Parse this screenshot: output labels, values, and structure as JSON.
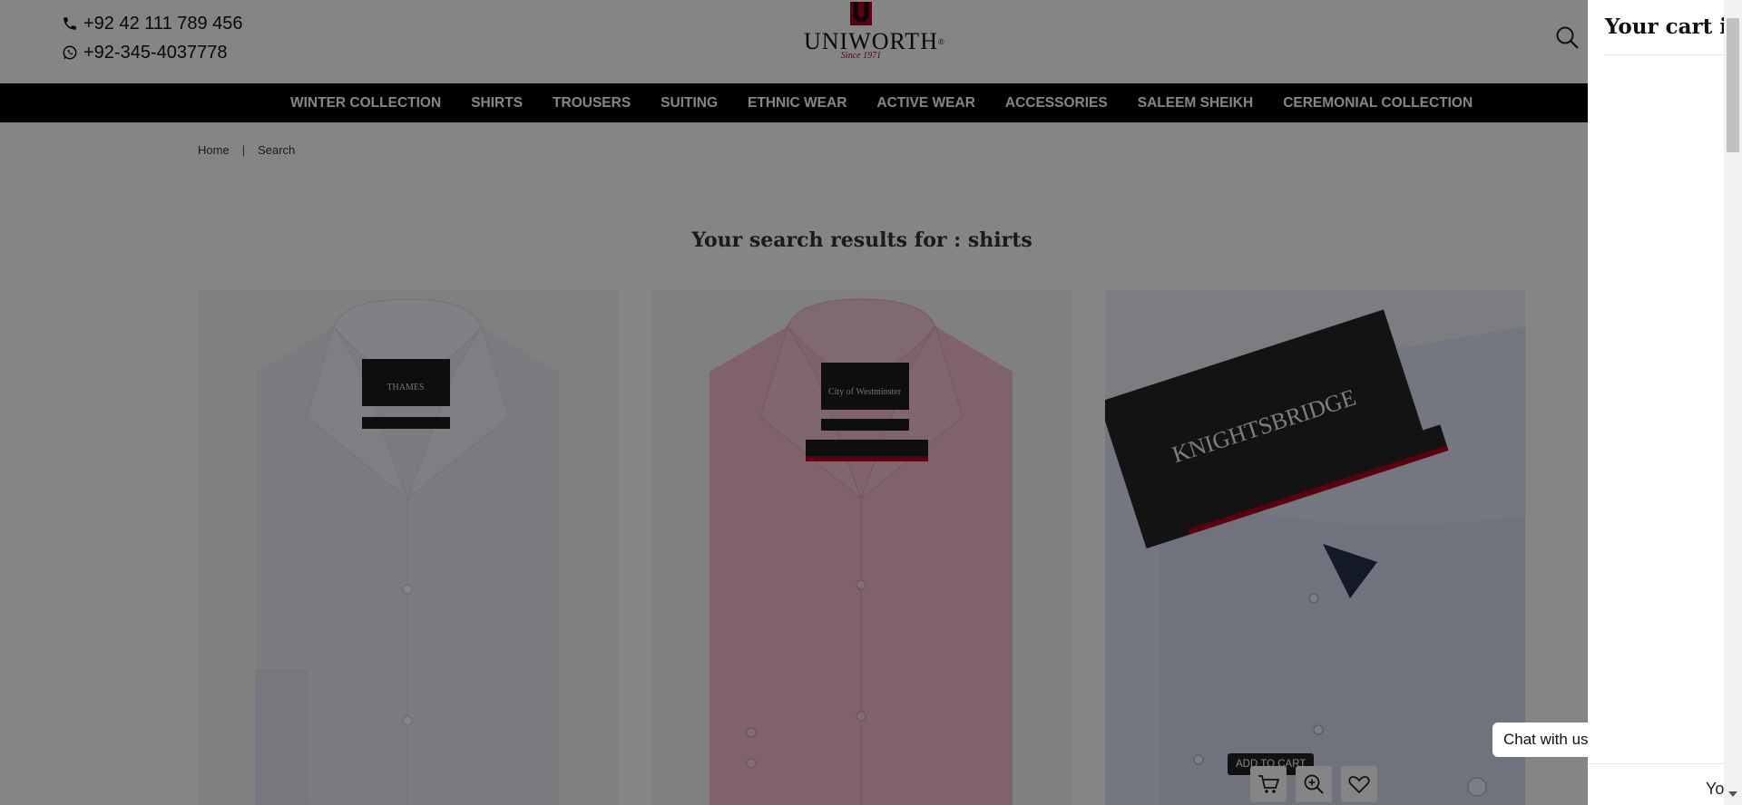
{
  "header": {
    "phone": "+92 42 111 789 456",
    "whatsapp": "+92-345-4037778",
    "logo": {
      "brand": "UNIWORTH",
      "reg": "®",
      "since": "Since 1971"
    },
    "search_icon": "search-icon"
  },
  "nav": {
    "items": [
      "WINTER COLLECTION",
      "SHIRTS",
      "TROUSERS",
      "SUITING",
      "ETHNIC WEAR",
      "ACTIVE WEAR",
      "ACCESSORIES",
      "SALEEM SHEIKH",
      "CEREMONIAL COLLECTION"
    ]
  },
  "breadcrumb": {
    "home": "Home",
    "separator": "|",
    "current": "Search"
  },
  "results": {
    "title": "Your search results for : shirts"
  },
  "products": [
    {
      "color": "#e9e9f6",
      "label": "THAMES"
    },
    {
      "color": "#f2b9c8",
      "label": "City of Westminster"
    },
    {
      "color": "#dfe4f5",
      "label": "KNIGHTSBRIDGE"
    }
  ],
  "product_tools": {
    "tooltip": "ADD TO CART",
    "icons": [
      "cart-icon",
      "zoom-icon",
      "heart-icon"
    ]
  },
  "chat": {
    "label": "Chat with us"
  },
  "cart_drawer": {
    "title": "Your cart is",
    "footer": "Yo"
  },
  "colors": {
    "nav_bg": "#000000",
    "brand_red": "#b00020",
    "overlay": "rgba(0,0,0,0.48)"
  }
}
